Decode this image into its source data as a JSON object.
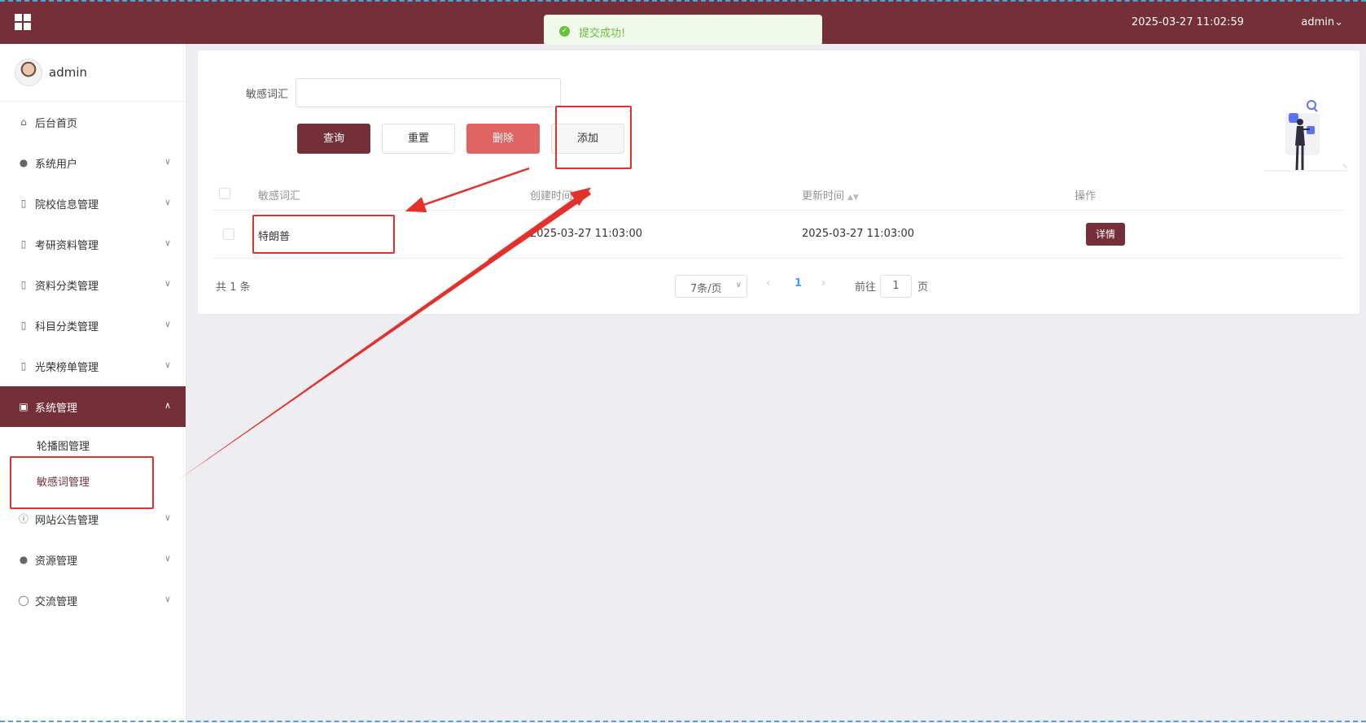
{
  "header": {
    "datetime": "2025-03-27 11:02:59",
    "user": "admin⌄"
  },
  "toast": {
    "message": "提交成功!",
    "type": "success",
    "color": "#67c23a"
  },
  "sidebar": {
    "username": "admin",
    "items": [
      {
        "label": "后台首页",
        "icon": "home-icon",
        "expandable": false
      },
      {
        "label": "系统用户",
        "icon": "user-icon",
        "expandable": true
      },
      {
        "label": "院校信息管理",
        "icon": "doc-icon",
        "expandable": true
      },
      {
        "label": "考研资料管理",
        "icon": "doc-icon",
        "expandable": true
      },
      {
        "label": "资料分类管理",
        "icon": "doc-icon",
        "expandable": true
      },
      {
        "label": "科目分类管理",
        "icon": "doc-icon",
        "expandable": true
      },
      {
        "label": "光荣榜单管理",
        "icon": "doc-icon",
        "expandable": true
      },
      {
        "label": "系统管理",
        "icon": "picture-icon",
        "expandable": true,
        "active": true
      },
      {
        "label": "网站公告管理",
        "icon": "info-icon",
        "expandable": true
      },
      {
        "label": "资源管理",
        "icon": "bulb-icon",
        "expandable": true
      },
      {
        "label": "交流管理",
        "icon": "chat-icon",
        "expandable": true
      }
    ],
    "subitems": [
      {
        "label": "轮播图管理"
      },
      {
        "label": "敏感词管理",
        "current": true
      }
    ]
  },
  "search": {
    "label": "敏感词汇",
    "value": "",
    "placeholder": ""
  },
  "buttons": {
    "query": "查询",
    "reset": "重置",
    "delete": "删除",
    "add": "添加"
  },
  "table": {
    "columns": [
      "敏感词汇",
      "创建时间",
      "更新时间",
      "操作"
    ],
    "rows": [
      {
        "word": "特朗普",
        "created": "2025-03-27 11:03:00",
        "updated": "2025-03-27 11:03:00",
        "action": "详情"
      }
    ]
  },
  "pagination": {
    "total": "共 1 条",
    "page_size": "7条/页",
    "current_page": "1",
    "goto_label": "前往",
    "goto_value": "1",
    "page_unit": "页"
  },
  "colors": {
    "primary": "#742f39",
    "danger": "#e06464",
    "link": "#409eff",
    "annotation": "#e4302b"
  }
}
